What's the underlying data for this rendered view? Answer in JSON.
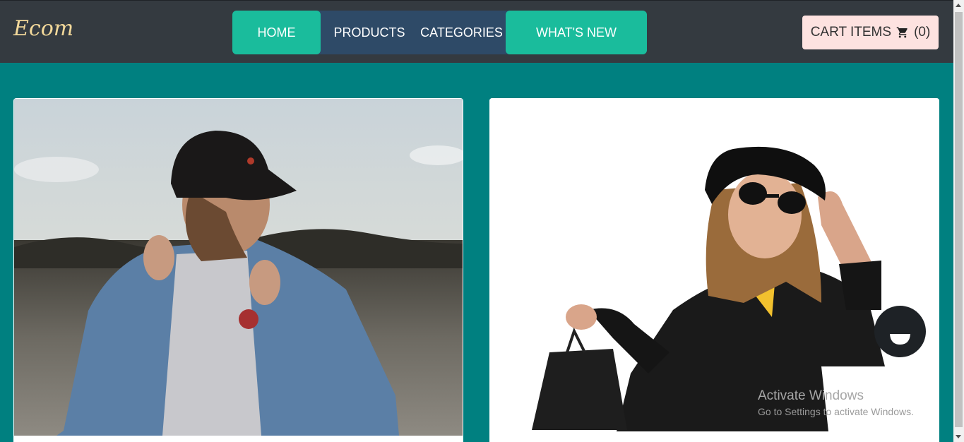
{
  "brand": {
    "logo_text": "Ecom"
  },
  "nav": {
    "items": [
      {
        "label": "HOME",
        "active": true
      },
      {
        "label": "PRODUCTS",
        "active": false
      },
      {
        "label": "CATEGORIES",
        "active": false
      },
      {
        "label": "WHAT'S NEW",
        "active": true
      }
    ]
  },
  "cart": {
    "label": "CART ITEMS",
    "icon": "cart-icon",
    "count": "(0)"
  },
  "cards": [
    {
      "image": "man-denim-jacket-cap-photo"
    },
    {
      "image": "woman-hat-sunglasses-shopping-bag-photo"
    }
  ],
  "chat": {
    "icon": "chat-smile-icon"
  },
  "watermark": {
    "title": "Activate Windows",
    "subtitle": "Go to Settings to activate Windows."
  },
  "colors": {
    "background": "#008080",
    "header": "#343a40",
    "nav_active": "#1abc9c",
    "nav_inactive": "#2e4a67",
    "cart_button": "#fde2e0",
    "logo": "#f2d89a"
  }
}
